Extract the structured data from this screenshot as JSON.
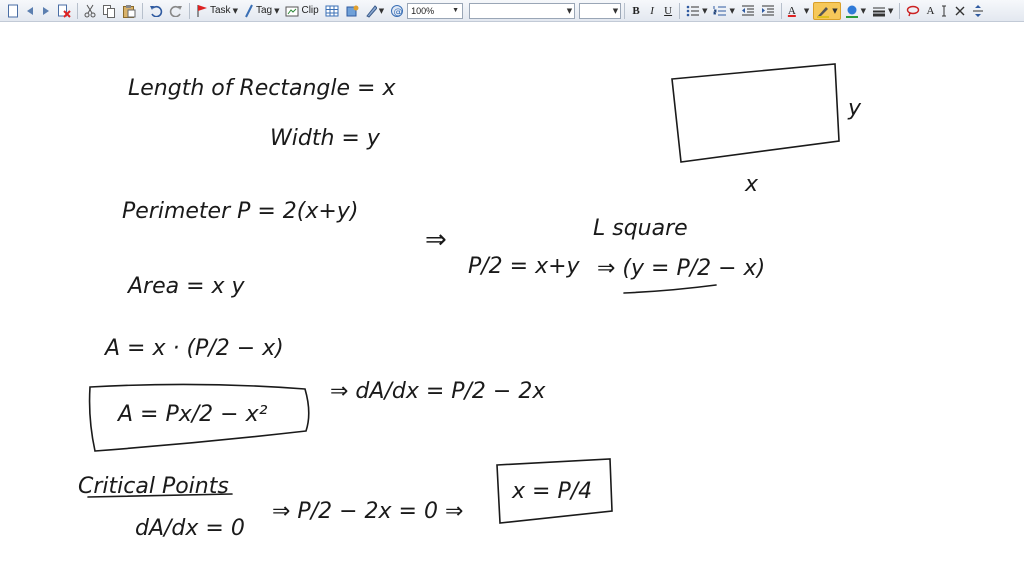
{
  "toolbar": {
    "task_label": "Task",
    "tag_label": "Tag",
    "clip_label": "Clip",
    "zoom_value": "100%",
    "bold_label": "B",
    "italic_label": "I",
    "underline_label": "U",
    "font_color_label": "A",
    "aa_label": "A",
    "accent_highlight": "#f6c85a"
  },
  "notes": {
    "length_line": "Length of Rectangle = x",
    "width_line": "Width = y",
    "perimeter_line": "Perimeter P = 2(x+y)",
    "arrow_mark": "⇒",
    "p_half_left": "P/2 = x+y",
    "square_note": "L square",
    "implies_y": "⇒ (y = P/2 − x)",
    "area_line": "Area = x y",
    "a_expr": "A = x · (P/2 − x)",
    "boxed_a": "A = Px/2 − x²",
    "derivative": "⇒ dA/dx = P/2 − 2x",
    "critical_points": "Critical Points",
    "da_dx_zero": "dA/dx = 0",
    "solve_line": "⇒ P/2 − 2x = 0 ⇒",
    "answer": "x = P/4",
    "rect_label_x": "x",
    "rect_label_y": "y",
    "ink_color": "#1a1a1a"
  }
}
